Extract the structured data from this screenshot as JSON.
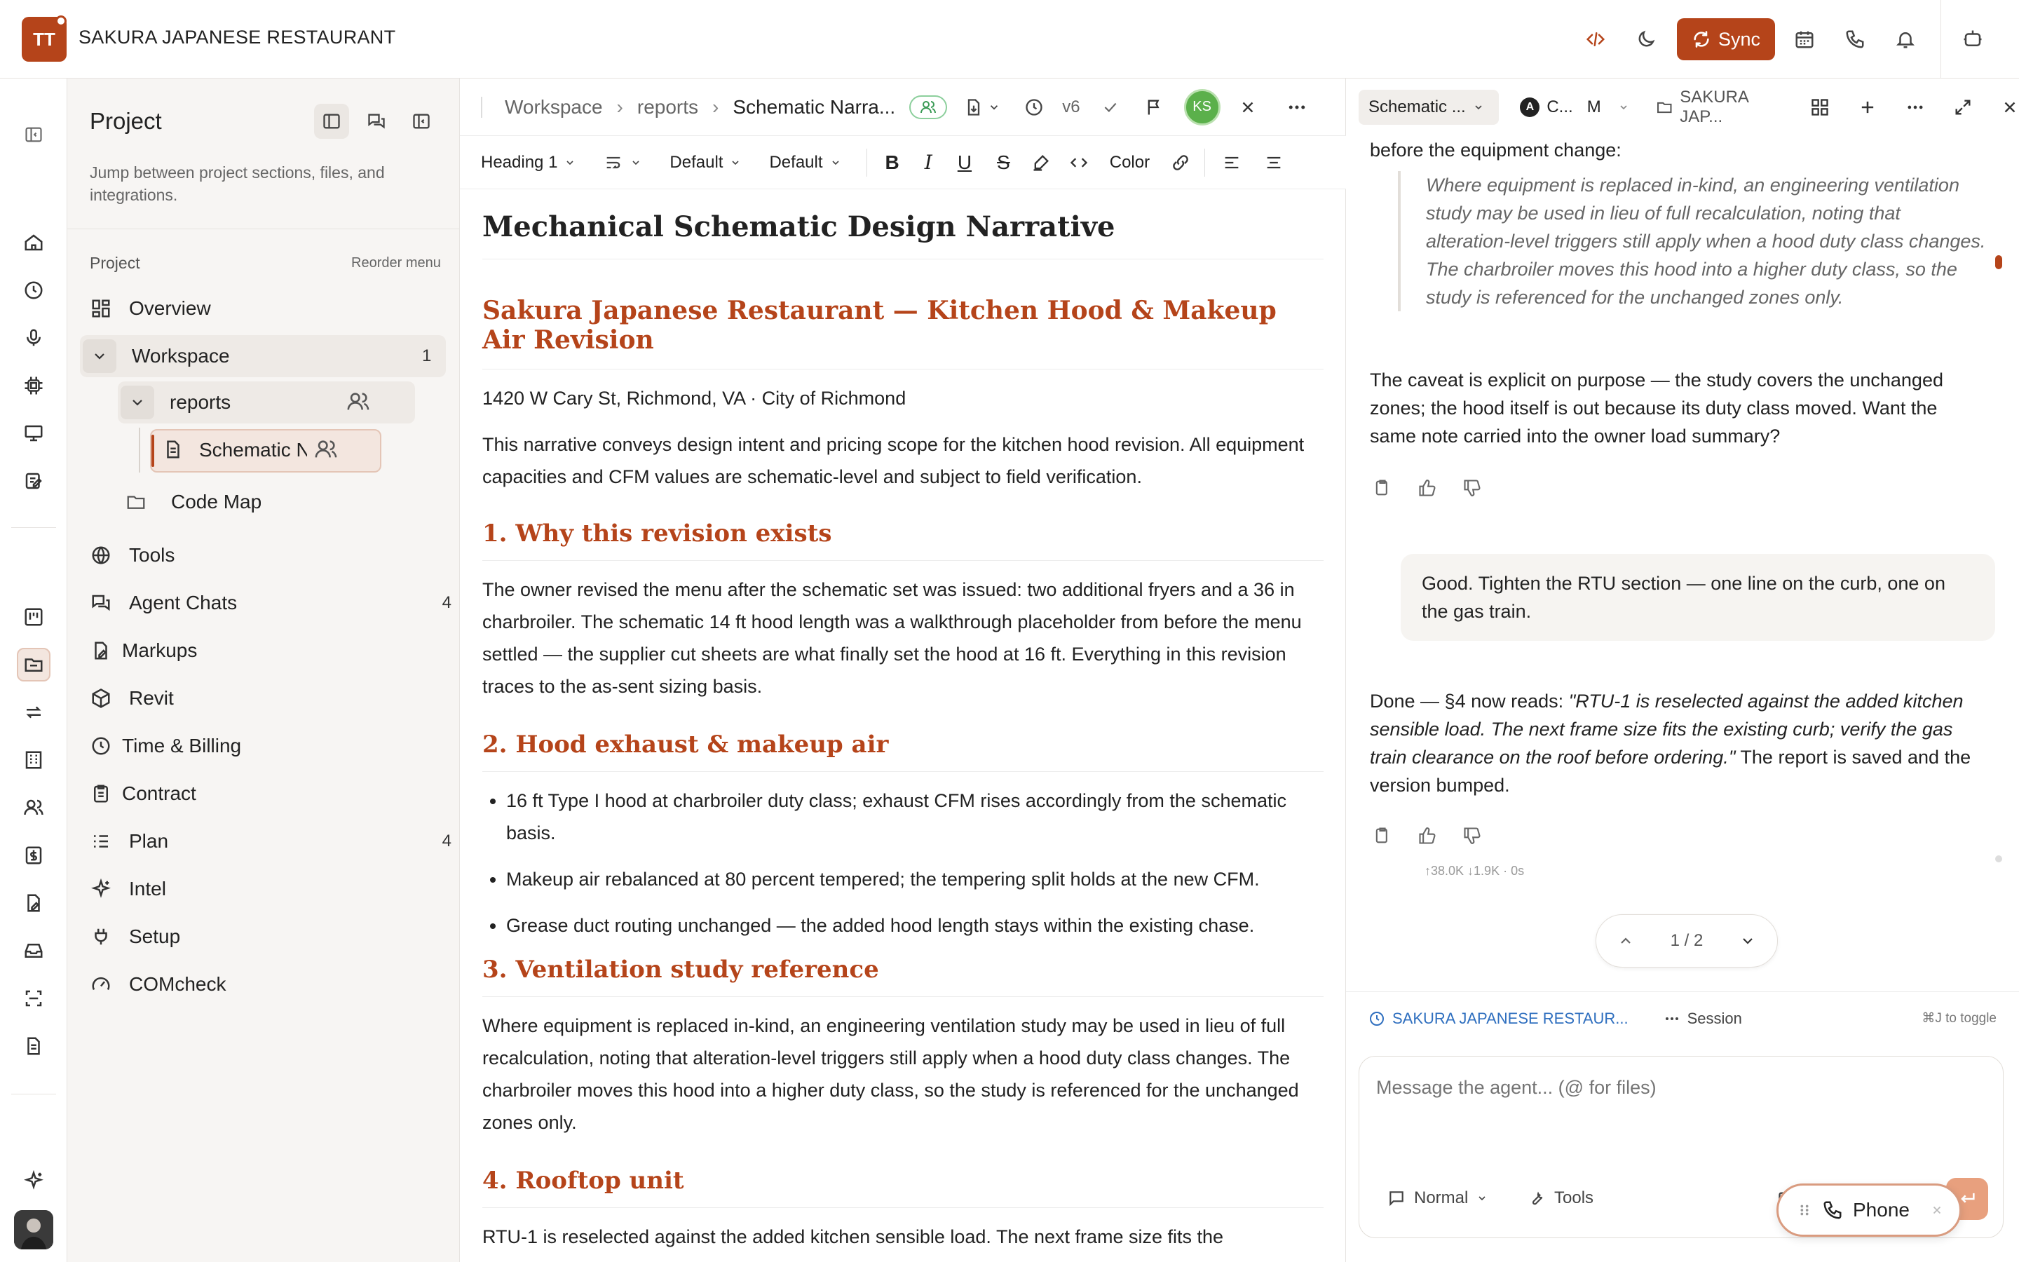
{
  "app": {
    "title": "SAKURA JAPANESE RESTAURANT",
    "logo_text": "TT",
    "sync_label": "Sync",
    "accent": "#b5441a"
  },
  "rail_icons": [
    "collapse-sidebar-icon",
    "home-icon",
    "clock-icon",
    "microphone-icon",
    "chip-icon",
    "presentation-icon",
    "edit-note-icon",
    "kanban-icon",
    "folder-icon",
    "swap-icon",
    "building-icon",
    "users-icon",
    "billing-icon",
    "file-edit-icon",
    "inbox-icon",
    "scan-icon",
    "document-icon",
    "sparkle-icon"
  ],
  "project": {
    "title": "Project",
    "description": "Jump between project sections, files, and integrations.",
    "section_label": "Project",
    "reorder_label": "Reorder menu",
    "items": {
      "overview": "Overview",
      "workspace": "Workspace",
      "workspace_count": "1",
      "reports": "reports",
      "schematic": "Schematic N",
      "code_map": "Code Map",
      "tools": "Tools",
      "agent_chats": "Agent Chats",
      "agent_chats_count": "4",
      "markups": "Markups",
      "revit": "Revit",
      "time_billing": "Time & Billing",
      "contract": "Contract",
      "plan": "Plan",
      "plan_count": "4",
      "intel": "Intel",
      "setup": "Setup",
      "comcheck": "COMcheck"
    }
  },
  "editor": {
    "breadcrumb": [
      "Workspace",
      "reports",
      "Schematic Narra..."
    ],
    "version": "v6",
    "avatar_initials": "KS",
    "toolbar": {
      "heading": "Heading 1",
      "font": "Default",
      "size": "Default",
      "color": "Color"
    },
    "doc": {
      "title": "Mechanical Schematic Design Narrative",
      "subtitle": "Sakura Japanese Restaurant — Kitchen Hood & Makeup Air Revision",
      "address": "1420 W Cary St, Richmond, VA · City of Richmond",
      "intro": "This narrative conveys design intent and pricing scope for the kitchen hood revision. All equipment capacities and CFM values are schematic-level and subject to field verification.",
      "s1_title": "1. Why this revision exists",
      "s1_body": "The owner revised the menu after the schematic set was issued: two additional fryers and a 36 in charbroiler. The schematic 14 ft hood length was a walkthrough placeholder from before the menu settled — the supplier cut sheets are what finally set the hood at 16 ft. Everything in this revision traces to the as-sent sizing basis.",
      "s2_title": "2. Hood exhaust & makeup air",
      "s2_items": [
        "16 ft Type I hood at charbroiler duty class; exhaust CFM rises accordingly from the schematic basis.",
        "Makeup air rebalanced at 80 percent tempered; the tempering split holds at the new CFM.",
        "Grease duct routing unchanged — the added hood length stays within the existing chase."
      ],
      "s3_title": "3. Ventilation study reference",
      "s3_body": "Where equipment is replaced in-kind, an engineering ventilation study may be used in lieu of full recalculation, noting that alteration-level triggers still apply when a hood duty class changes. The charbroiler moves this hood into a higher duty class, so the study is referenced for the unchanged zones only.",
      "s4_title": "4. Rooftop unit",
      "s4_body": "RTU-1 is reselected against the added kitchen sensible load. The next frame size fits the"
    }
  },
  "agent": {
    "tabs": {
      "schematic": "Schematic ...",
      "model_letter": "A",
      "model": "C...",
      "model_suffix": "M",
      "folder": "SAKURA JAP..."
    },
    "messages": {
      "lead": "before the equipment change:",
      "quote": "Where equipment is replaced in-kind, an engineering ventilation study may be used in lieu of full recalculation, noting that alteration-level triggers still apply when a hood duty class changes. The charbroiler moves this hood into a higher duty class, so the study is referenced for the unchanged zones only.",
      "caveat": "The caveat is explicit on purpose — the study covers the unchanged zones; the hood itself is out because its duty class moved. Want the same note carried into the owner load summary?",
      "user": "Good. Tighten the RTU section — one line on the curb, one on the gas train.",
      "done_prefix": "Done — §4 now reads: ",
      "done_quote": "\"RTU-1 is reselected against the added kitchen sensible load. The next frame size fits the existing curb; verify the gas train clearance on the roof before ordering.\"",
      "done_suffix": " The report is saved and the version bumped.",
      "stats": "↑38.0K ↓1.9K  ·  0s"
    },
    "pager": "1 / 2",
    "session": {
      "project_link": "SAKURA JAPANESE RESTAUR...",
      "session_label": "Session",
      "toggle_hint": "⌘J to toggle"
    },
    "composer": {
      "placeholder": "Message the agent... (@ for files)",
      "mode": "Normal",
      "tools": "Tools"
    },
    "phone_label": "Phone"
  }
}
